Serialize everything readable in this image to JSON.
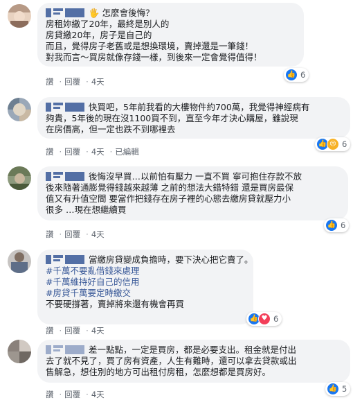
{
  "comments": [
    {
      "emoji": "🖐",
      "lines": [
        "怎麼會後悔？",
        "房租妳繳了20年，最終是別人的",
        "房貸繳20年，房子是自己的",
        "而且，覺得房子老舊或是想換環境，賣掉還是一筆錢！",
        "對我而言～買房就像存錢一樣，到後來一定會覺得值得！"
      ],
      "actions": {
        "like": "讚",
        "reply": "回覆",
        "time": "4天",
        "edited": ""
      },
      "reaction_count": "6"
    },
    {
      "lines": [
        "快買吧，5年前我看的大樓物件約700萬，我覺得神經病有",
        "夠貴，5年後的現在沒1100買不到，直至今年才決心購屋，雖說現",
        "在房價高，但一定也跌不到哪裡去"
      ],
      "actions": {
        "like": "讚",
        "reply": "回覆",
        "time": "4天",
        "edited": "已編輯"
      },
      "reaction_count": "6"
    },
    {
      "lines": [
        "後悔沒早買…以前怕有壓力 一直不買 寧可抱住存款不放",
        "後來隨著通膨覺得錢越來越薄 之前的想法大錯特錯 還是買房最保",
        "值又有升值空間 要當作把錢存在房子裡的心態去繳房貸就壓力小",
        "很多 …現在想繼續買"
      ],
      "actions": {
        "like": "讚",
        "reply": "回覆",
        "time": "4天",
        "edited": ""
      },
      "reaction_count": "6"
    },
    {
      "lines": [
        "當繳房貸變成負擔時，要下決心把它賣了。"
      ],
      "hashtags": [
        "#千萬不要亂借錢來處理",
        "#千萬維持好自己的信用",
        "#房貸千萬要定時繳交"
      ],
      "tail": "不要硬撐著，賣掉將來還有機會再買",
      "actions": {
        "like": "讚",
        "reply": "回覆",
        "time": "4天",
        "edited": ""
      },
      "reaction_count": "6"
    },
    {
      "lines": [
        "差一點點，一定是買房，都是必要支出。租金就是付出",
        "去了就不見了，買了房有資產，人生有難時，還可以拿去貸款或出",
        "售解急，想住別的地方可出租付房租，怎麼想都是買房好。"
      ],
      "actions": {
        "like": "讚",
        "reply": "回覆",
        "time": "4天",
        "edited": ""
      },
      "reaction_count": "5"
    }
  ],
  "colors": {
    "bubble": "#f2f3f5",
    "name": "#385898",
    "like": "#1877f2",
    "heart": "#f33e58",
    "haha": "#f7b125"
  }
}
